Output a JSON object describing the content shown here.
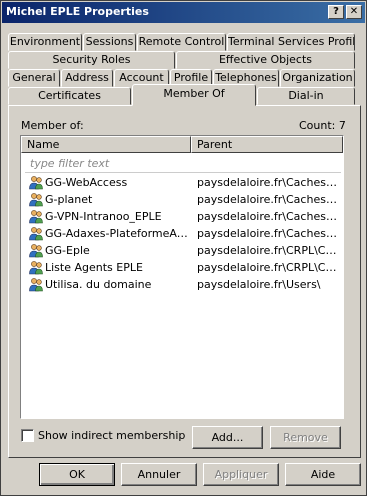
{
  "window": {
    "title": "Michel EPLE Properties",
    "help_glyph": "?",
    "close_glyph": "✕"
  },
  "tabs": {
    "row1": [
      "Environment",
      "Sessions",
      "Remote Control",
      "Terminal Services Profile"
    ],
    "row2": [
      "Security Roles",
      "Effective Objects"
    ],
    "row3": [
      "General",
      "Address",
      "Account",
      "Profile",
      "Telephones",
      "Organization"
    ],
    "row4": [
      "Certificates",
      "Member Of",
      "Dial-in"
    ],
    "active": "Member Of"
  },
  "member_of": {
    "label": "Member of:",
    "count": "Count: 7",
    "columns": [
      "Name",
      "Parent"
    ],
    "filter_placeholder": "type filter text",
    "rows": [
      {
        "name": "GG-WebAccess",
        "parent": "paysdelaloire.fr\\Caches a..."
      },
      {
        "name": "G-planet",
        "parent": "paysdelaloire.fr\\Caches a..."
      },
      {
        "name": "G-VPN-Intranoo_EPLE",
        "parent": "paysdelaloire.fr\\Caches a..."
      },
      {
        "name": "GG-Adaxes-PlateformeAca...",
        "parent": "paysdelaloire.fr\\Caches a..."
      },
      {
        "name": "GG-Eple",
        "parent": "paysdelaloire.fr\\CRPL\\CR..."
      },
      {
        "name": "Liste Agents EPLE",
        "parent": "paysdelaloire.fr\\CRPL\\CR..."
      },
      {
        "name": "Utilisa. du domaine",
        "parent": "paysdelaloire.fr\\Users\\"
      }
    ],
    "show_indirect_label": "Show indirect membership",
    "show_indirect_checked": false,
    "add_label": "Add...",
    "remove_label": "Remove"
  },
  "footer": {
    "ok_label": "OK",
    "cancel_label": "Annuler",
    "apply_label": "Appliquer",
    "help_label": "Aide"
  }
}
